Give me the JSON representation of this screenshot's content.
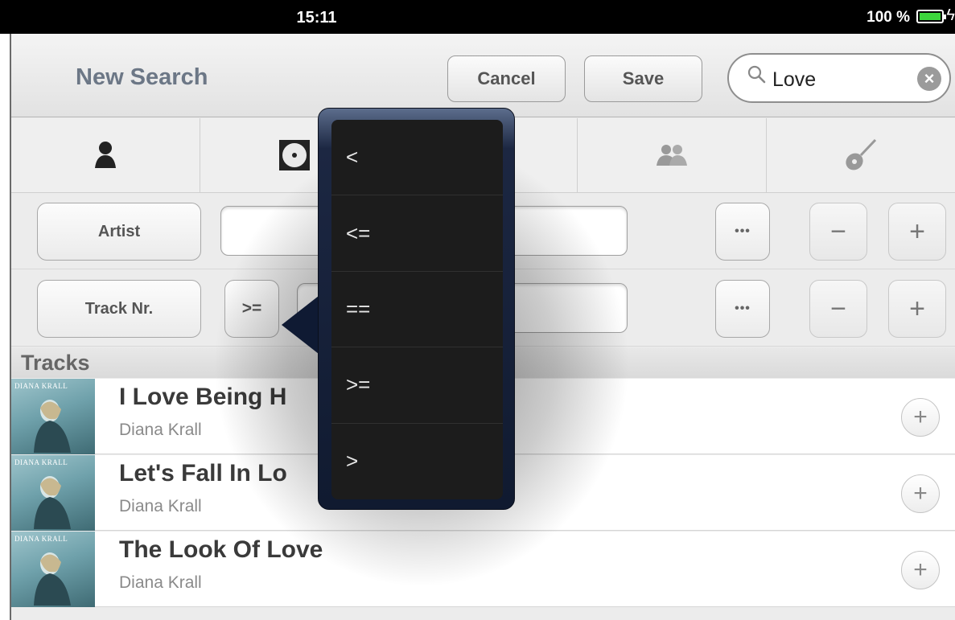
{
  "status_bar": {
    "time": "15:11",
    "battery": "100 %"
  },
  "navbar": {
    "title": "New Search",
    "cancel_label": "Cancel",
    "save_label": "Save",
    "search_value": "Love"
  },
  "tabs": [
    {
      "icon": "person-icon"
    },
    {
      "icon": "album-icon"
    },
    {
      "icon": "hidden-tab"
    },
    {
      "icon": "group-icon"
    },
    {
      "icon": "guitar-icon"
    }
  ],
  "filters": [
    {
      "field_label": "Artist"
    },
    {
      "field_label": "Track Nr.",
      "operator_label": ">="
    }
  ],
  "filter_more_label": "•••",
  "filter_minus_label": "−",
  "filter_plus_label": "+",
  "tracks_section_title": "Tracks",
  "album_cover_text": "DIANA KRALL",
  "tracks": [
    {
      "title": "I Love Being H",
      "artist": "Diana Krall"
    },
    {
      "title": "Let's Fall In Lo",
      "artist": "Diana Krall"
    },
    {
      "title": "The Look Of Love",
      "artist": "Diana Krall"
    }
  ],
  "add_label": "+",
  "operator_menu": [
    "<",
    "<=",
    "==",
    ">=",
    ">"
  ],
  "colors": {
    "title": "#6c7786",
    "battery": "#3cd53c",
    "popover": "#1c2742"
  }
}
